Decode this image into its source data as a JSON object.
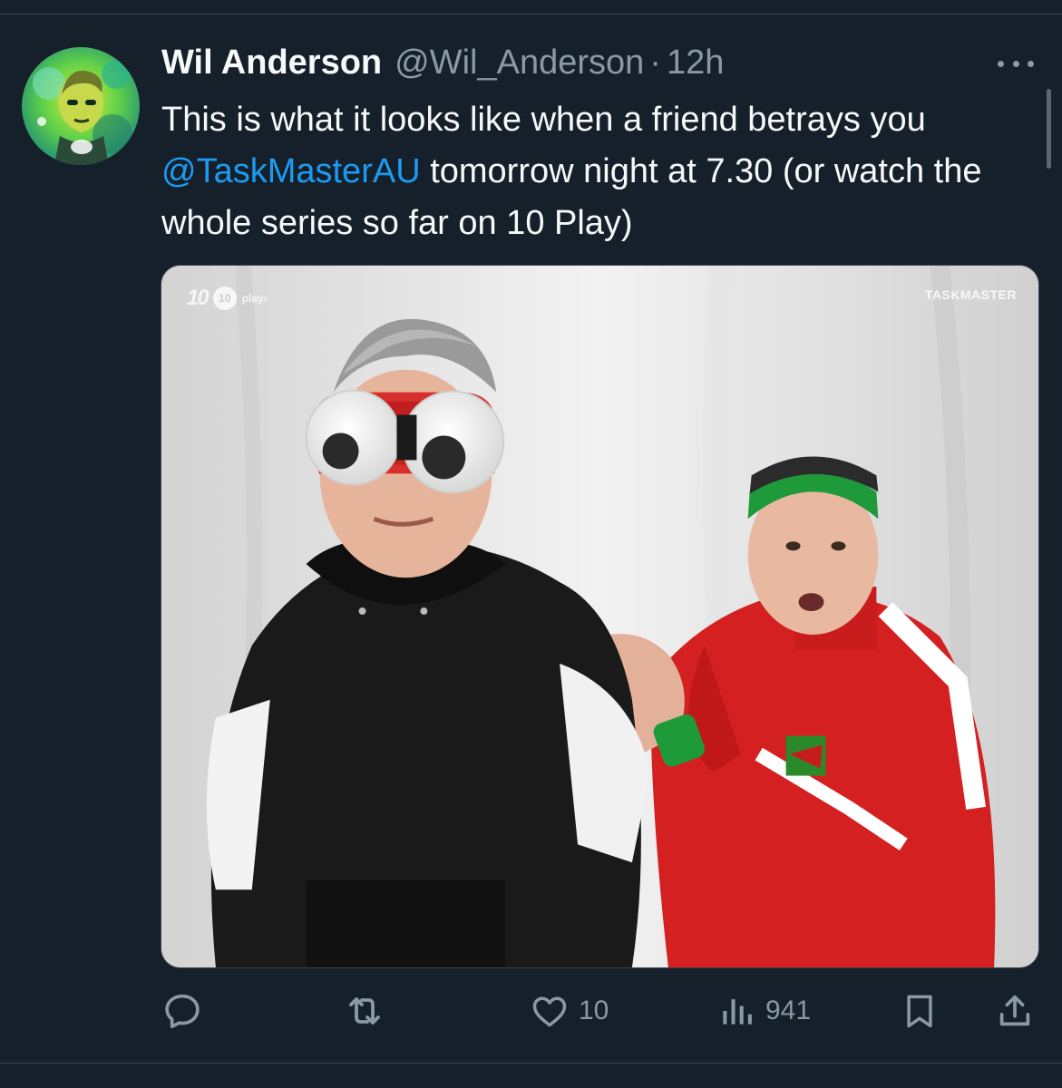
{
  "tweet": {
    "display_name": "Wil Anderson",
    "handle": "@Wil_Anderson",
    "separator": "·",
    "time": "12h",
    "text_before": "This is what it looks like when a friend betrays you ",
    "mention": "@TaskMasterAU",
    "text_after": " tomorrow night at 7.30 (or watch the whole series so far on 10 Play)"
  },
  "media": {
    "watermark_left_ten": "10",
    "watermark_left_badge": "10",
    "watermark_left_play": "play›",
    "watermark_right": "TASKMASTER"
  },
  "actions": {
    "reply_icon": "reply-icon",
    "retweet_icon": "retweet-icon",
    "like_icon": "heart-icon",
    "like_count": "10",
    "views_icon": "views-icon",
    "views_count": "941",
    "bookmark_icon": "bookmark-icon",
    "share_icon": "share-icon"
  },
  "colors": {
    "background": "#15202b",
    "text": "#f7f9f9",
    "muted": "#8b98a5",
    "link": "#1d9bf0",
    "border": "#38444d"
  }
}
